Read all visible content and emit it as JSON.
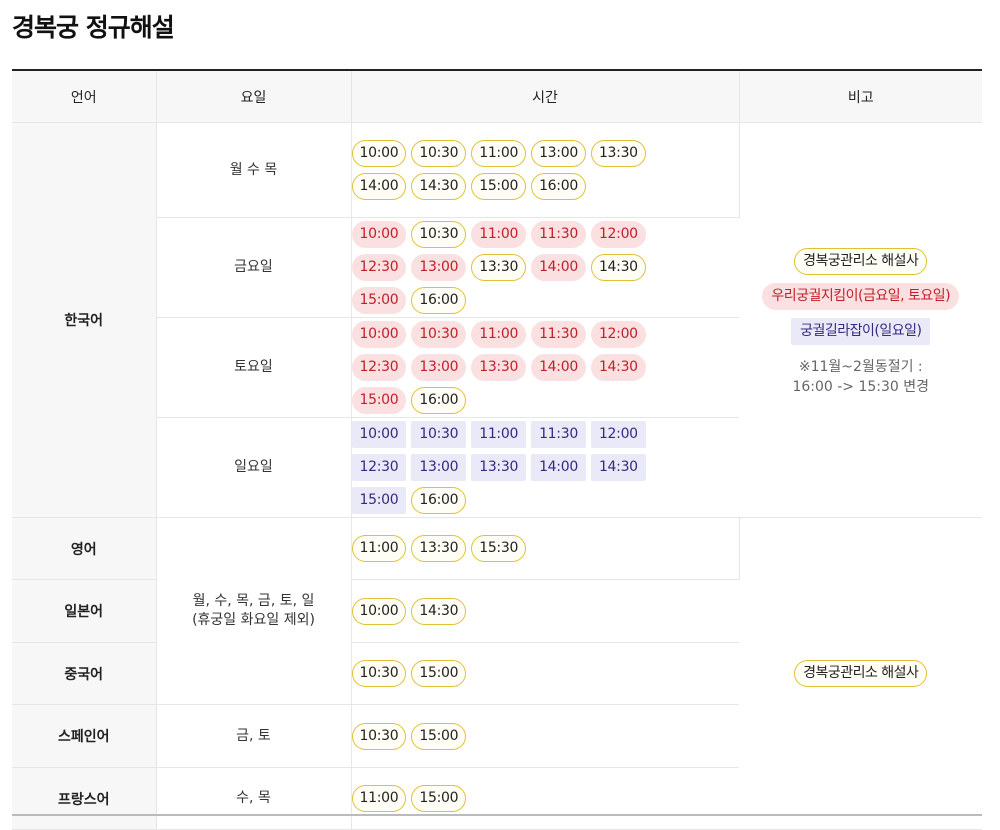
{
  "title": "경복궁 정규해설",
  "headers": {
    "language": "언어",
    "days": "요일",
    "time": "시간",
    "note": "비고"
  },
  "korean": {
    "language": "한국어",
    "rows": [
      {
        "days": "월 수 목",
        "times": [
          {
            "t": "10:00",
            "s": "yellow"
          },
          {
            "t": "10:30",
            "s": "yellow"
          },
          {
            "t": "11:00",
            "s": "yellow"
          },
          {
            "t": "13:00",
            "s": "yellow"
          },
          {
            "t": "13:30",
            "s": "yellow"
          },
          {
            "t": "14:00",
            "s": "yellow"
          },
          {
            "t": "14:30",
            "s": "yellow"
          },
          {
            "t": "15:00",
            "s": "yellow"
          },
          {
            "t": "16:00",
            "s": "yellow"
          }
        ]
      },
      {
        "days": "금요일",
        "times": [
          {
            "t": "10:00",
            "s": "red"
          },
          {
            "t": "10:30",
            "s": "yellow"
          },
          {
            "t": "11:00",
            "s": "red"
          },
          {
            "t": "11:30",
            "s": "red"
          },
          {
            "t": "12:00",
            "s": "red"
          },
          {
            "t": "12:30",
            "s": "red"
          },
          {
            "t": "13:00",
            "s": "red"
          },
          {
            "t": "13:30",
            "s": "yellow"
          },
          {
            "t": "14:00",
            "s": "red"
          },
          {
            "t": "14:30",
            "s": "yellow"
          },
          {
            "t": "15:00",
            "s": "red"
          },
          {
            "t": "16:00",
            "s": "yellow"
          }
        ]
      },
      {
        "days": "토요일",
        "times": [
          {
            "t": "10:00",
            "s": "red"
          },
          {
            "t": "10:30",
            "s": "red"
          },
          {
            "t": "11:00",
            "s": "red"
          },
          {
            "t": "11:30",
            "s": "red"
          },
          {
            "t": "12:00",
            "s": "red"
          },
          {
            "t": "12:30",
            "s": "red"
          },
          {
            "t": "13:00",
            "s": "red"
          },
          {
            "t": "13:30",
            "s": "red"
          },
          {
            "t": "14:00",
            "s": "red"
          },
          {
            "t": "14:30",
            "s": "red"
          },
          {
            "t": "15:00",
            "s": "red"
          },
          {
            "t": "16:00",
            "s": "yellow"
          }
        ]
      },
      {
        "days": "일요일",
        "times": [
          {
            "t": "10:00",
            "s": "purple"
          },
          {
            "t": "10:30",
            "s": "purple"
          },
          {
            "t": "11:00",
            "s": "purple"
          },
          {
            "t": "11:30",
            "s": "purple"
          },
          {
            "t": "12:00",
            "s": "purple"
          },
          {
            "t": "12:30",
            "s": "purple"
          },
          {
            "t": "13:00",
            "s": "purple"
          },
          {
            "t": "13:30",
            "s": "purple"
          },
          {
            "t": "14:00",
            "s": "purple"
          },
          {
            "t": "14:30",
            "s": "purple"
          },
          {
            "t": "15:00",
            "s": "purple"
          },
          {
            "t": "16:00",
            "s": "yellow"
          }
        ]
      }
    ],
    "note": {
      "badges": [
        {
          "label": "경복궁관리소 해설사",
          "s": "yellow"
        },
        {
          "label": "우리궁궐지킴이(금요일, 토요일)",
          "s": "red"
        },
        {
          "label": "궁궐길라잡이(일요일)",
          "s": "purple"
        }
      ],
      "text_line1": "※11월~2월동절기 :",
      "text_line2": "16:00 -> 15:30 변경"
    }
  },
  "foreign": {
    "shared_days_line1": "월, 수, 목, 금, 토, 일",
    "shared_days_line2": "(휴궁일 화요일 제외)",
    "note_badge": "경복궁관리소 해설사",
    "rows": [
      {
        "language": "영어",
        "times": [
          "11:00",
          "13:30",
          "15:30"
        ]
      },
      {
        "language": "일본어",
        "times": [
          "10:00",
          "14:30"
        ]
      },
      {
        "language": "중국어",
        "times": [
          "10:30",
          "15:00"
        ]
      },
      {
        "language": "스페인어",
        "days": "금, 토",
        "times": [
          "10:30",
          "15:00"
        ]
      },
      {
        "language": "프랑스어",
        "days": "수, 목",
        "times": [
          "11:00",
          "15:00"
        ]
      }
    ]
  },
  "colors": {
    "yellow_border": "#e0c035",
    "red_bg": "#fae0e0",
    "red_text": "#c0202a",
    "purple_bg": "#eae9f8",
    "purple_text": "#332b80",
    "header_bg": "#f7f7f7"
  }
}
